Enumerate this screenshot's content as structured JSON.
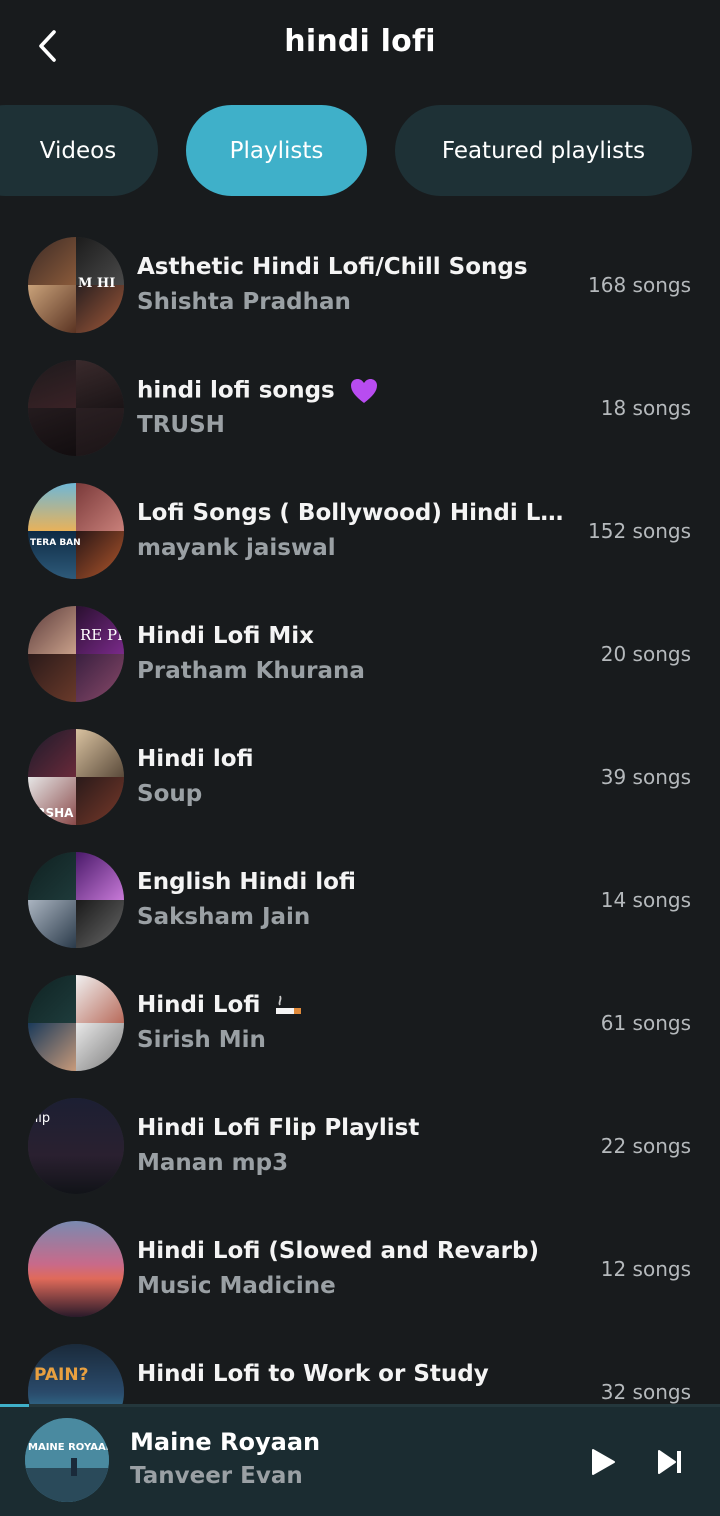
{
  "header": {
    "title": "hindi lofi",
    "back_icon": "arrow-back-icon"
  },
  "tabs": [
    {
      "label": "Videos",
      "active": false
    },
    {
      "label": "Playlists",
      "active": true
    },
    {
      "label": "Featured playlists",
      "active": false
    }
  ],
  "colors": {
    "accent": "#3fb0c9",
    "background": "#181b1d",
    "tab_inactive": "#1e3136",
    "player_bg": "#1b2c31",
    "subtext": "#9aa0a4"
  },
  "playlists": [
    {
      "title": "Asthetic Hindi Lofi/Chill Songs",
      "owner": "Shishta Pradhan",
      "count": "168 songs",
      "thumb_text": "M HI"
    },
    {
      "title": "hindi lofi songs",
      "emoji": "purple-heart-icon",
      "owner": "TRUSH",
      "count": "18 songs",
      "thumb_text": ""
    },
    {
      "title": "Lofi Songs ( Bollywood) Hindi Lofi s...",
      "owner": "mayank jaiswal",
      "count": "152 songs",
      "thumb_text": "TERA BAN"
    },
    {
      "title": "Hindi Lofi Mix",
      "owner": "Pratham Khurana",
      "count": "20 songs",
      "thumb_text": "RE PI"
    },
    {
      "title": "Hindi lofi",
      "owner": "Soup",
      "count": "39 songs",
      "thumb_text": "ERSHA"
    },
    {
      "title": "English Hindi lofi",
      "owner": "Saksham Jain",
      "count": "14 songs",
      "thumb_text": ""
    },
    {
      "title": "Hindi Lofi",
      "emoji": "cigarette-icon",
      "owner": "Sirish Min",
      "count": "61 songs",
      "thumb_text": ""
    },
    {
      "title": "Hindi Lofi Flip Playlist",
      "owner": "Manan mp3",
      "count": "22 songs",
      "thumb_text": "-lip"
    },
    {
      "title": "Hindi Lofi (Slowed and Revarb)",
      "owner": "Music Madicine",
      "count": "12 songs",
      "thumb_text": ""
    },
    {
      "title": "Hindi Lofi to Work or Study",
      "owner": "",
      "count": "32 songs",
      "thumb_text": "PAIN?"
    }
  ],
  "player": {
    "title": "Maine Royaan",
    "artist": "Tanveer Evan",
    "art_text": "MAINE ROYAAN",
    "progress": 0.04,
    "play_icon": "play-icon",
    "next_icon": "skip-next-icon"
  }
}
